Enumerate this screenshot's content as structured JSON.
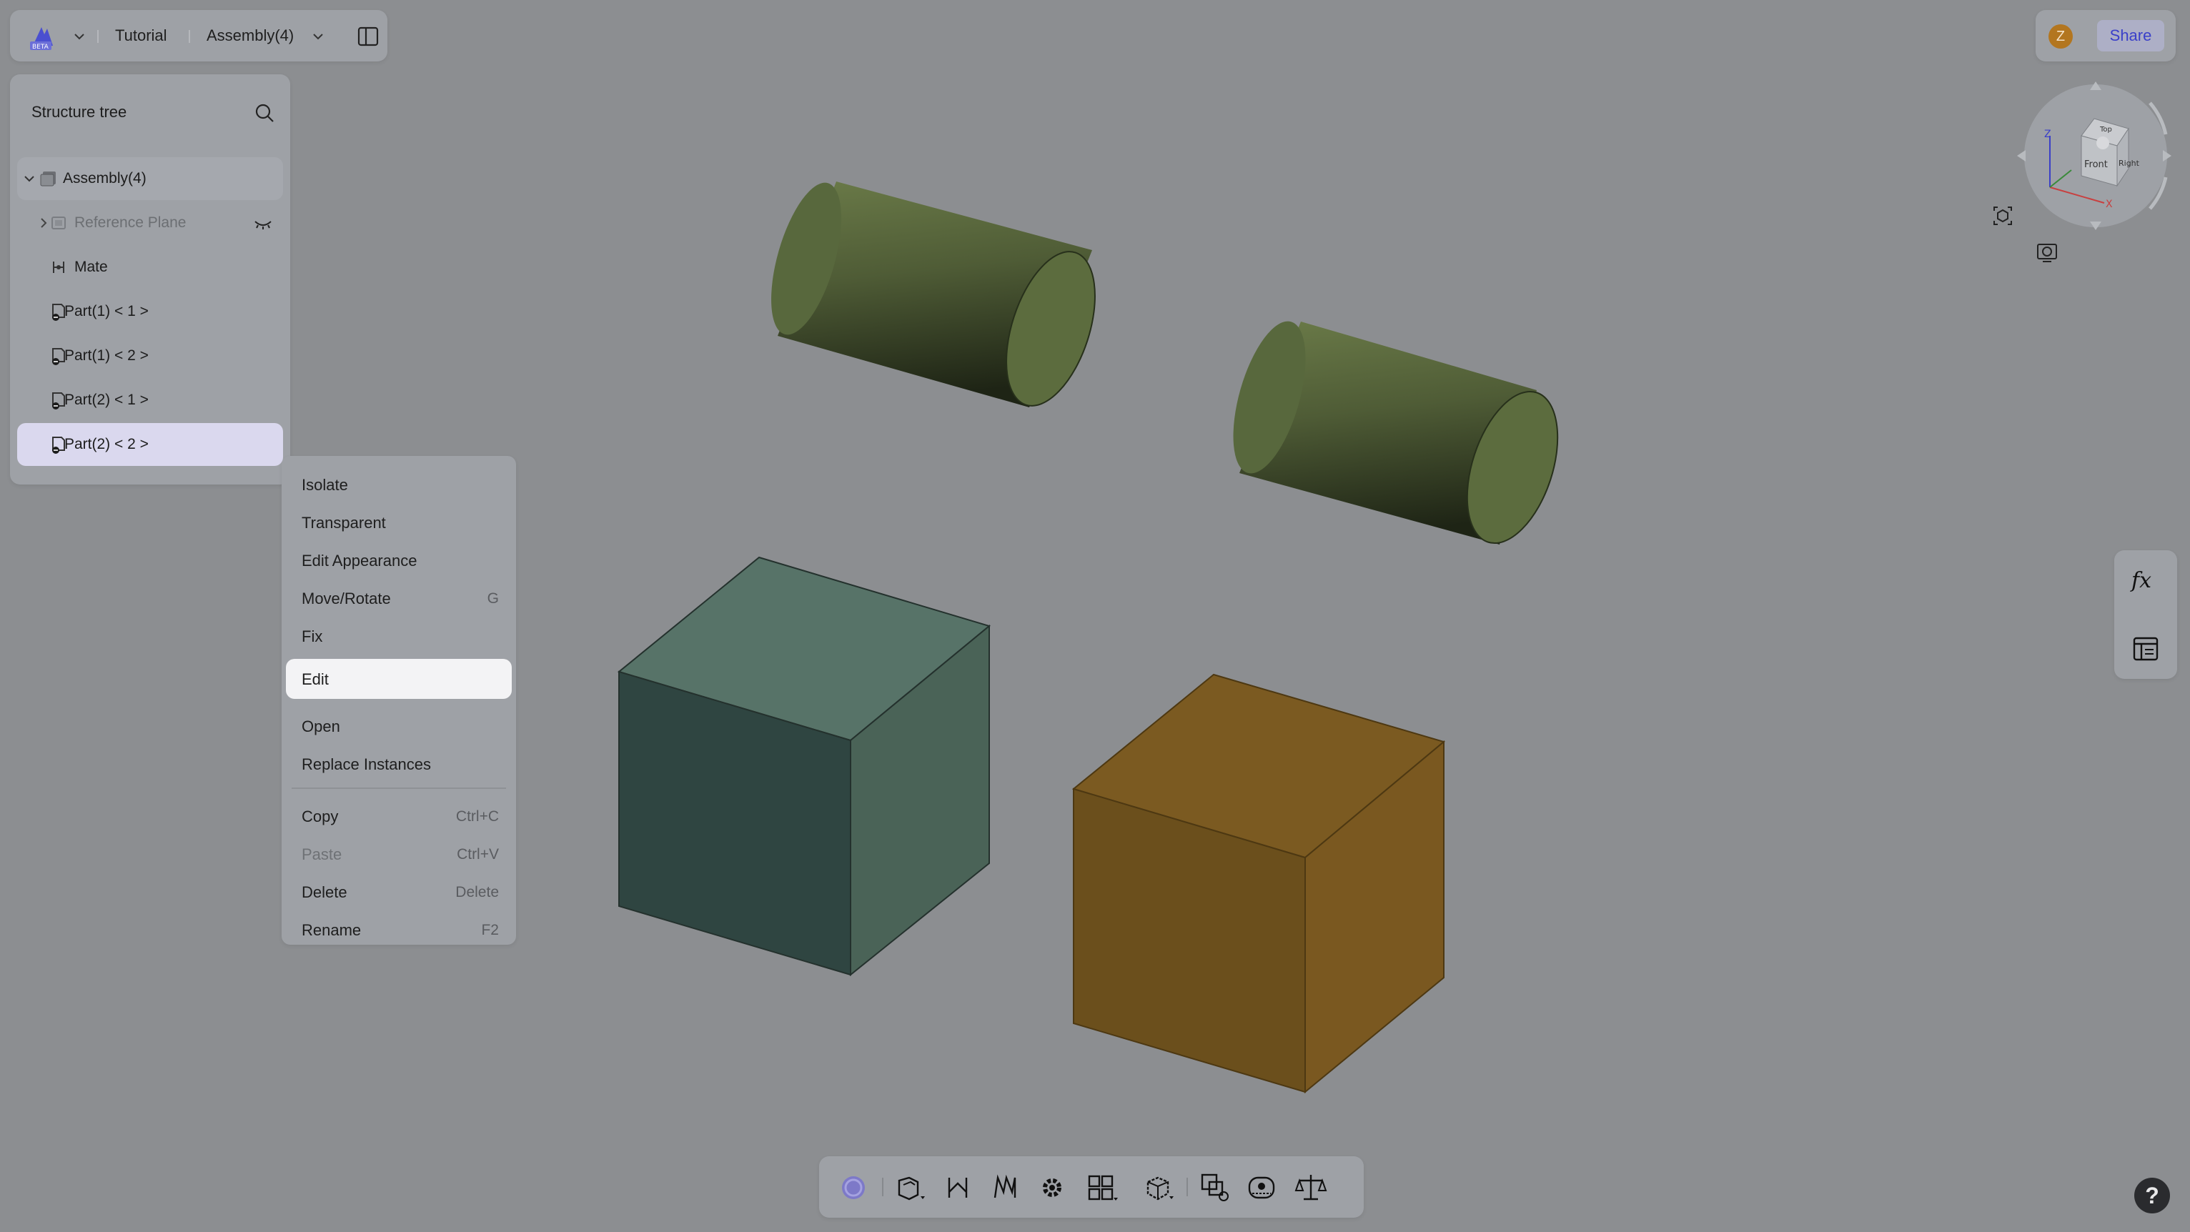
{
  "header": {
    "logo_icon": "app-logo-beta-icon",
    "project": "Tutorial",
    "document": "Assembly(4)",
    "panel_toggle_icon": "sidebar-toggle-icon"
  },
  "user": {
    "avatar_initial": "Z",
    "share_label": "Share",
    "avatar_color": "#b3761f"
  },
  "structure_tree": {
    "title": "Structure tree",
    "search_icon": "search-icon",
    "items": [
      {
        "label": "Assembly(4)",
        "icon": "assembly-icon",
        "expanded": true
      },
      {
        "label": "Reference Plane",
        "icon": "reference-plane-icon",
        "hidden": true
      },
      {
        "label": "Mate",
        "icon": "mate-icon"
      },
      {
        "label": "Part(1) < 1 >",
        "icon": "part-instance-icon"
      },
      {
        "label": "Part(1) < 2 >",
        "icon": "part-instance-icon"
      },
      {
        "label": "Part(2) < 1 >",
        "icon": "part-instance-icon"
      },
      {
        "label": "Part(2) < 2 >",
        "icon": "part-instance-icon",
        "selected": true
      }
    ]
  },
  "context_menu": {
    "items": [
      {
        "label": "Isolate",
        "shortcut": ""
      },
      {
        "label": "Transparent",
        "shortcut": ""
      },
      {
        "label": "Edit Appearance",
        "shortcut": ""
      },
      {
        "label": "Move/Rotate",
        "shortcut": "G"
      },
      {
        "label": "Fix",
        "shortcut": ""
      },
      {
        "label": "Edit",
        "shortcut": "",
        "highlighted": true
      },
      {
        "label": "Open",
        "shortcut": ""
      },
      {
        "label": "Replace Instances",
        "shortcut": ""
      },
      {
        "label": "Copy",
        "shortcut": "Ctrl+C"
      },
      {
        "label": "Paste",
        "shortcut": "Ctrl+V",
        "disabled": true
      },
      {
        "label": "Delete",
        "shortcut": "Delete"
      },
      {
        "label": "Rename",
        "shortcut": "F2"
      }
    ]
  },
  "view_cube": {
    "faces": {
      "top": "Top",
      "front": "Front",
      "right": "Right"
    },
    "axes": {
      "x": "X",
      "z": "Z"
    }
  },
  "side_tools": {
    "formula_icon": "fx-icon",
    "properties_icon": "properties-panel-icon",
    "camera_icon": "camera-fit-icon",
    "render_icon": "render-mode-icon",
    "help_label": "?"
  },
  "toolbar": {
    "tools": [
      "select-icon",
      "insert-part-icon",
      "mate-icon",
      "linear-pattern-icon",
      "settings-gear-icon",
      "pattern-grid-icon",
      "explode-view-icon",
      "interference-check-icon",
      "measure-tape-icon",
      "mass-properties-icon"
    ]
  },
  "colors": {
    "background": "#8c8e91",
    "cylinder": "#5f6d42",
    "teal_cube": "#4d685f",
    "orange_cube": "#7a5a20",
    "selection": "#dad8ee",
    "accent": "#3b40c9"
  }
}
